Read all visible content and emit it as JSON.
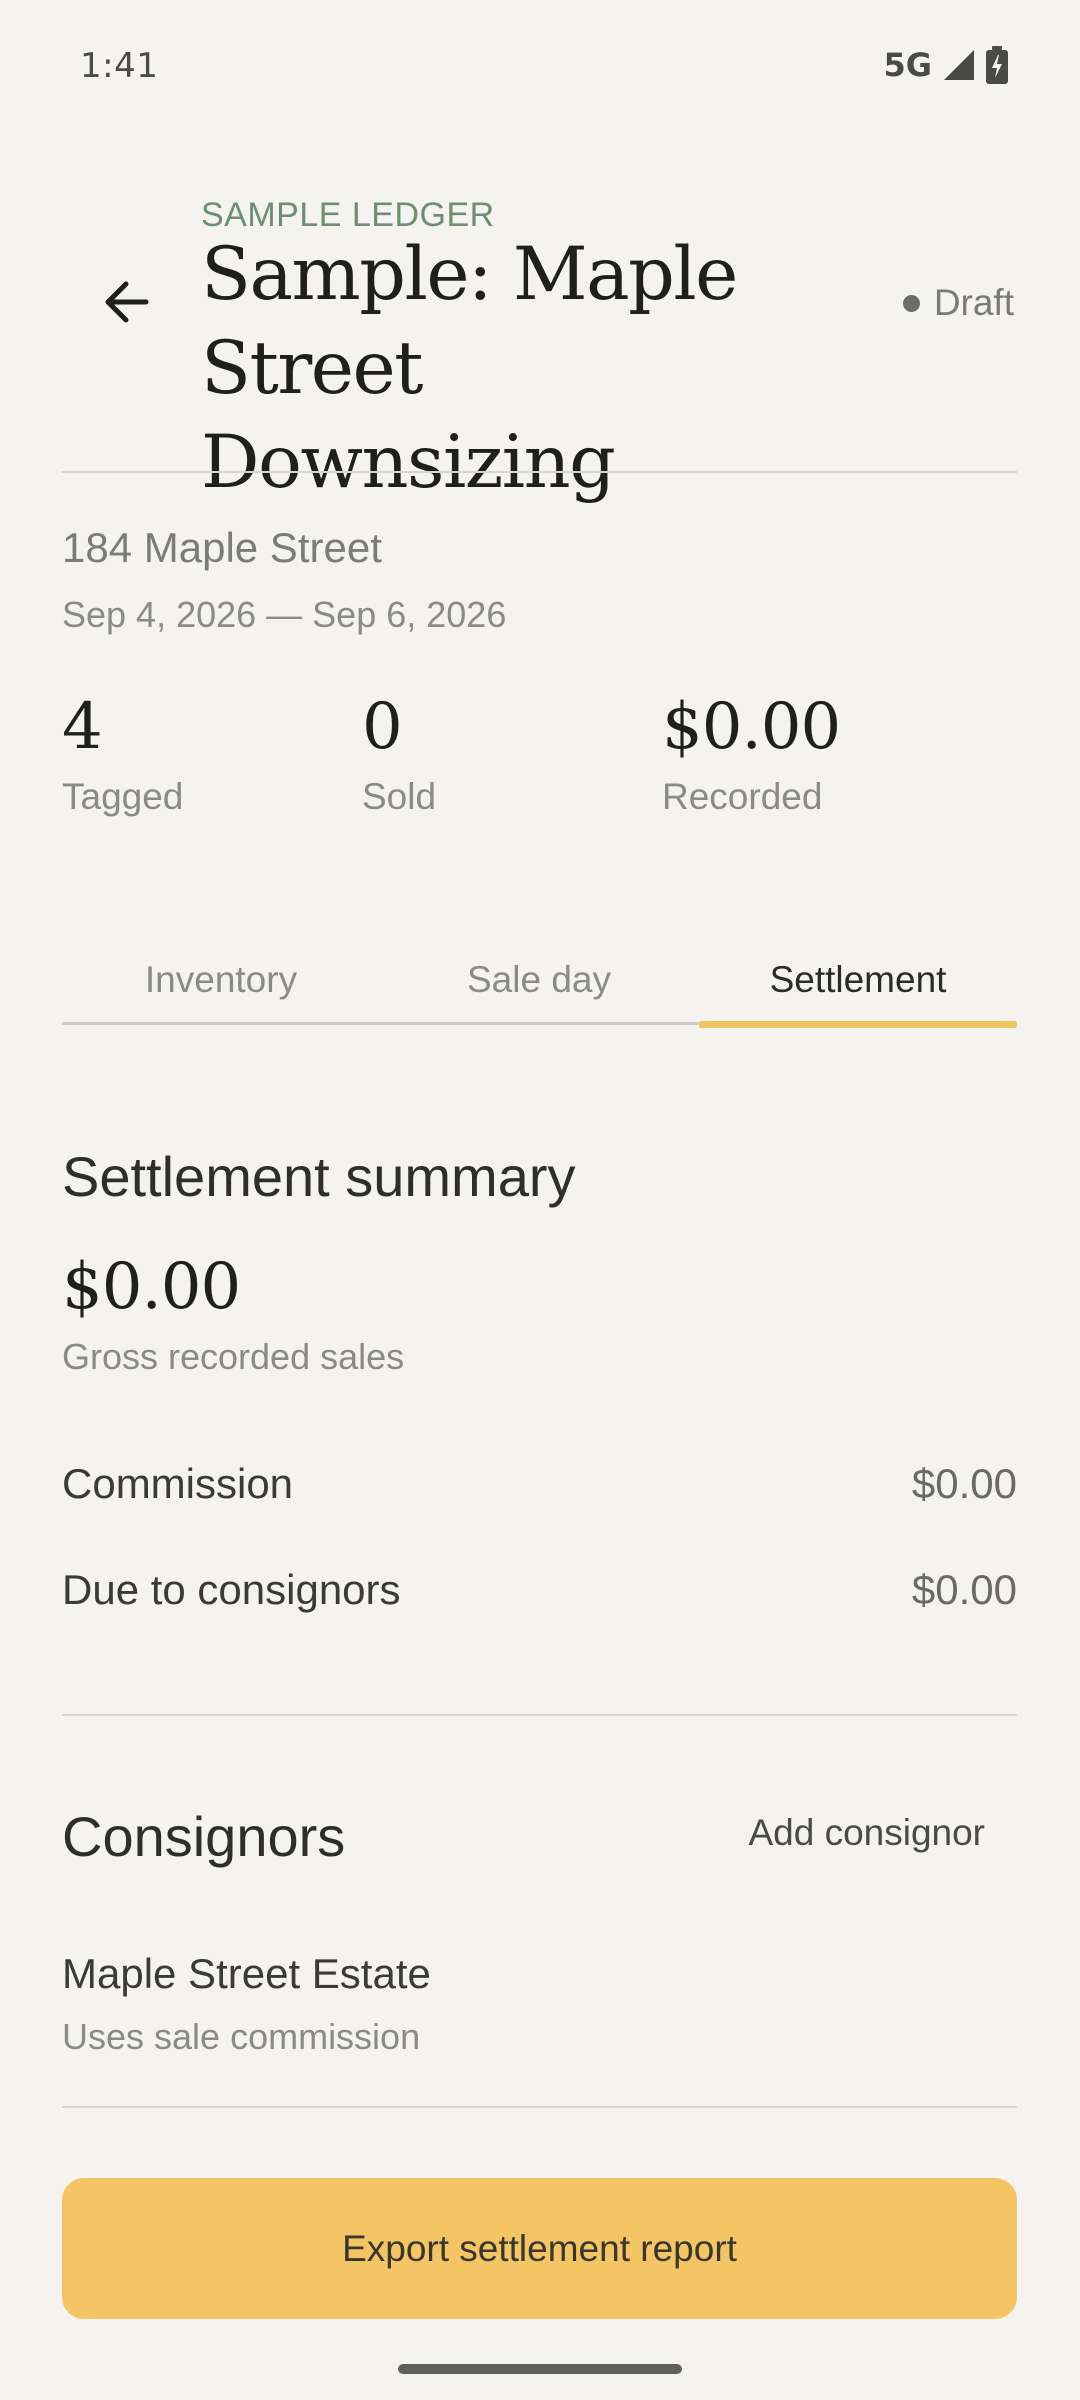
{
  "status_bar": {
    "time": "1:41",
    "network": "5G",
    "icons": [
      "signal-icon",
      "battery-charging-icon"
    ]
  },
  "header": {
    "back_icon": "arrow-left-icon",
    "eyebrow": "SAMPLE LEDGER",
    "title": "Sample: Maple Street Downsizing",
    "status": "Draft",
    "status_color": "#6B6D68"
  },
  "sale": {
    "address": "184 Maple Street",
    "dates": "Sep 4, 2026 — Sep 6, 2026"
  },
  "stats": [
    {
      "value": "4",
      "label": "Tagged"
    },
    {
      "value": "0",
      "label": "Sold"
    },
    {
      "value": "$0.00",
      "label": "Recorded"
    }
  ],
  "tabs": {
    "items": [
      {
        "label": "Inventory"
      },
      {
        "label": "Sale day"
      },
      {
        "label": "Settlement"
      }
    ],
    "active": "Settlement",
    "indicator_color": "#F2C460"
  },
  "settlement": {
    "title": "Settlement summary",
    "gross_amount": "$0.00",
    "gross_label": "Gross recorded sales",
    "rows": [
      {
        "label": "Commission",
        "value": "$0.00"
      },
      {
        "label": "Due to consignors",
        "value": "$0.00"
      }
    ]
  },
  "consignors": {
    "title": "Consignors",
    "add_label": "Add consignor",
    "items": [
      {
        "name": "Maple Street Estate",
        "detail": "Uses sale commission"
      }
    ]
  },
  "export": {
    "label": "Export settlement report",
    "color": "#F3C564"
  }
}
